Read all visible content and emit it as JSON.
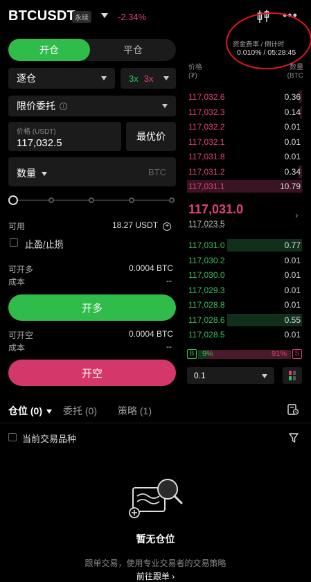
{
  "header": {
    "symbol": "BTCUSDT",
    "contract_tag": "永续",
    "change": "-2.34%",
    "icons": [
      "candlestick-icon",
      "more-icon"
    ]
  },
  "order_form": {
    "tab_open": "开仓",
    "tab_close": "平仓",
    "margin_mode": "逐仓",
    "leverage_long": "3x",
    "leverage_short": "3x",
    "order_type": "限价委托",
    "price_label": "价格 (USDT)",
    "price_value": "117,032.5",
    "best_price": "最优价",
    "qty_label": "数量",
    "qty_unit": "BTC",
    "slider_value_pct": 0,
    "available_label": "可用",
    "available_value": "18.27 USDT",
    "tpsl_label": "止盈/止损",
    "can_long_label": "可开多",
    "can_long_value": "0.0004 BTC",
    "cost_label_1": "成本",
    "cost_value_1": "--",
    "long_button": "开多",
    "can_short_label": "可开空",
    "can_short_value": "0.0004 BTC",
    "cost_label_2": "成本",
    "cost_value_2": "--",
    "short_button": "开空"
  },
  "order_book": {
    "funding_label": "资金费率 / 倒计时",
    "funding_value": "0.010% / 05:28:45",
    "head_price_1": "价格",
    "head_price_2": "(₮)",
    "head_qty_1": "数量",
    "head_qty_2": "(BTC",
    "asks": [
      {
        "price": "117,032.6",
        "qty": "0.36",
        "depth": 0.03
      },
      {
        "price": "117,032.3",
        "qty": "0.14",
        "depth": 0.02
      },
      {
        "price": "117,032.2",
        "qty": "0.01",
        "depth": 0.0
      },
      {
        "price": "117,032.1",
        "qty": "0.01",
        "depth": 0.0
      },
      {
        "price": "117,031.8",
        "qty": "0.01",
        "depth": 0.0
      },
      {
        "price": "117,031.2",
        "qty": "0.34",
        "depth": 0.03
      },
      {
        "price": "117,031.1",
        "qty": "10.79",
        "depth": 1.0
      }
    ],
    "last_price": "117,031.0",
    "mark_price": "117,023.5",
    "bids": [
      {
        "price": "117,031.0",
        "qty": "0.77",
        "depth": 0.65
      },
      {
        "price": "117,030.2",
        "qty": "0.01",
        "depth": 0.0
      },
      {
        "price": "117,030.0",
        "qty": "0.01",
        "depth": 0.0
      },
      {
        "price": "117,029.3",
        "qty": "0.01",
        "depth": 0.0
      },
      {
        "price": "117,028.8",
        "qty": "0.01",
        "depth": 0.0
      },
      {
        "price": "117,028.6",
        "qty": "0.55",
        "depth": 0.65
      },
      {
        "price": "117,028.5",
        "qty": "0.01",
        "depth": 0.0
      }
    ],
    "buy_tag": "B",
    "sell_tag": "S",
    "buy_pct": "9%",
    "sell_pct": "91%",
    "buy_ratio": 0.09,
    "depth_step": "0.1"
  },
  "bottom": {
    "tab_positions": "仓位 (0)",
    "tab_orders": "委托 (0)",
    "tab_strategy": "策略 (1)",
    "current_symbol_only": "当前交易品种",
    "empty_title": "暂无仓位",
    "empty_desc": "跟单交易，使用专业交易者的交易策略",
    "empty_link": "前往跟单 ›"
  },
  "colors": {
    "green": "#2fbc4a",
    "red": "#d4386b",
    "annotation_circle": "#e3161e"
  }
}
